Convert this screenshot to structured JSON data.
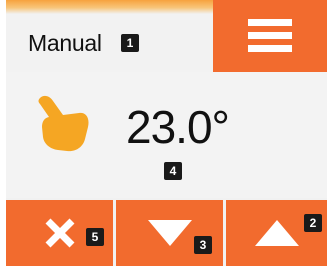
{
  "header": {
    "mode_label": "Manual",
    "menu_icon": "hamburger-menu-icon"
  },
  "main": {
    "mode_icon": "hand-icon",
    "temperature": "23.0°"
  },
  "buttons": [
    {
      "name": "cancel",
      "icon": "close-icon"
    },
    {
      "name": "decrease",
      "icon": "triangle-down-icon"
    },
    {
      "name": "increase",
      "icon": "triangle-up-icon"
    }
  ],
  "badges": [
    "1",
    "2",
    "3",
    "4",
    "5"
  ],
  "colors": {
    "accent": "#f26b2e",
    "hand": "#f5a623",
    "background": "#f1f1f1",
    "text": "#111111",
    "badge": "#1a1a1a"
  }
}
